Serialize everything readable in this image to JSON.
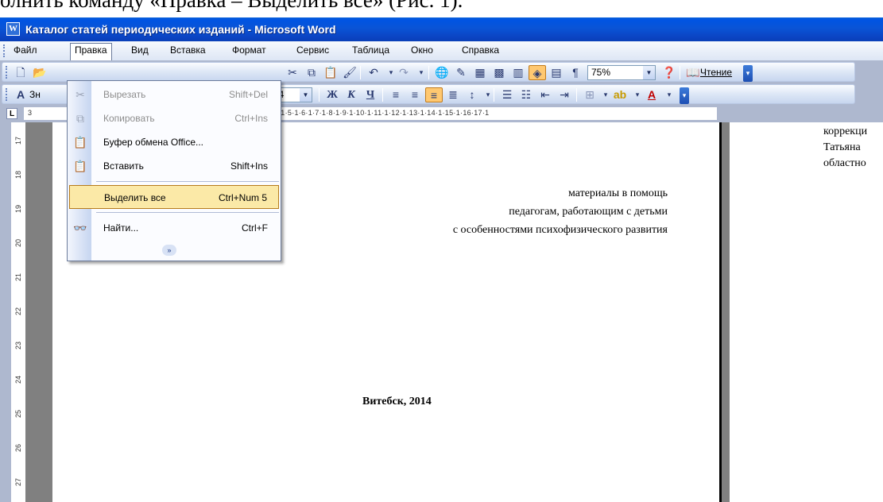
{
  "caption": "олнить команду «Правка – Выделить все» (Рис. 1).",
  "window": {
    "title": "Каталог статей периодических изданий - Microsoft Word",
    "icon": "word-document-icon"
  },
  "menubar": {
    "items": [
      {
        "label": "Файл"
      },
      {
        "label": "Правка"
      },
      {
        "label": "Вид"
      },
      {
        "label": "Вставка"
      },
      {
        "label": "Формат"
      },
      {
        "label": "Сервис"
      },
      {
        "label": "Таблица"
      },
      {
        "label": "Окно"
      },
      {
        "label": "Справка"
      }
    ]
  },
  "toolbar": {
    "zoom": "75%",
    "font_size": "14",
    "reading_label": "Чтение",
    "style_fragment": "Зн",
    "bold": "Ж",
    "italic": "К",
    "underline": "Ч",
    "pilcrow": "¶"
  },
  "ruler": {
    "corner": "L",
    "lead": "3",
    "marks": "·1·5·1·6·1·7·1·8·1·9·1·10·1·11·1·12·1·13·1·14·1·15·1·16·17·1",
    "vertical": [
      "17",
      "18",
      "19",
      "20",
      "21",
      "22",
      "23",
      "24",
      "25",
      "26",
      "27"
    ]
  },
  "menu": {
    "items": [
      {
        "label": "Вырезать",
        "shortcut": "Shift+Del",
        "icon": "scissors-icon"
      },
      {
        "label": "Копировать",
        "shortcut": "Ctrl+Ins",
        "icon": "copy-icon"
      },
      {
        "label": "Буфер обмена Office...",
        "shortcut": "",
        "icon": "office-clipboard-icon"
      },
      {
        "label": "Вставить",
        "shortcut": "Shift+Ins",
        "icon": "paste-icon"
      },
      {
        "label": "Выделить все",
        "shortcut": "Ctrl+Num 5",
        "icon": ""
      },
      {
        "label": "Найти...",
        "shortcut": "Ctrl+F",
        "icon": "binoculars-icon"
      }
    ],
    "expand_icon": "double-chevron-down-icon"
  },
  "document": {
    "lines": [
      "материалы в помощь",
      "педагогам, работающим с детьми",
      "с особенностями психофизического развития"
    ],
    "city": "Витебск, 2014",
    "next_page_lines": [
      "коррекци",
      "Татьяна",
      "областно"
    ]
  }
}
